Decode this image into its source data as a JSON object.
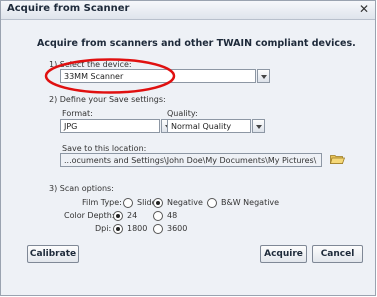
{
  "window": {
    "title": "Acquire from Scanner",
    "close_glyph": "✕"
  },
  "heading": "Acquire from scanners and other TWAIN compliant devices.",
  "device": {
    "label": "1) Select the device:",
    "value": "33MM Scanner"
  },
  "save": {
    "label": "2) Define your Save settings:",
    "format_label": "Format:",
    "format_value": "JPG",
    "quality_label": "Quality:",
    "quality_value": "Normal Quality",
    "location_label": "Save to this location:",
    "location_value": "...ocuments and Settings\\John Doe\\My Documents\\My Pictures\\"
  },
  "scan": {
    "label": "3) Scan options:",
    "film_type_label": "Film Type:",
    "film_types": [
      "Slide",
      "Negative",
      "B&W Negative"
    ],
    "film_type_selected": "Negative",
    "color_depth_label": "Color Depth:",
    "color_depths": [
      "24",
      "48"
    ],
    "color_depth_selected": "24",
    "dpi_label": "Dpi:",
    "dpis": [
      "1800",
      "3600"
    ],
    "dpi_selected": "1800"
  },
  "buttons": {
    "calibrate": "Calibrate",
    "acquire": "Acquire",
    "cancel": "Cancel"
  },
  "colors": {
    "highlight_circle": "#e01010",
    "folder_icon": "#e9c45a"
  },
  "icons": {
    "dropdown": "chevron-down-icon",
    "folder": "folder-icon",
    "close": "close-icon"
  }
}
